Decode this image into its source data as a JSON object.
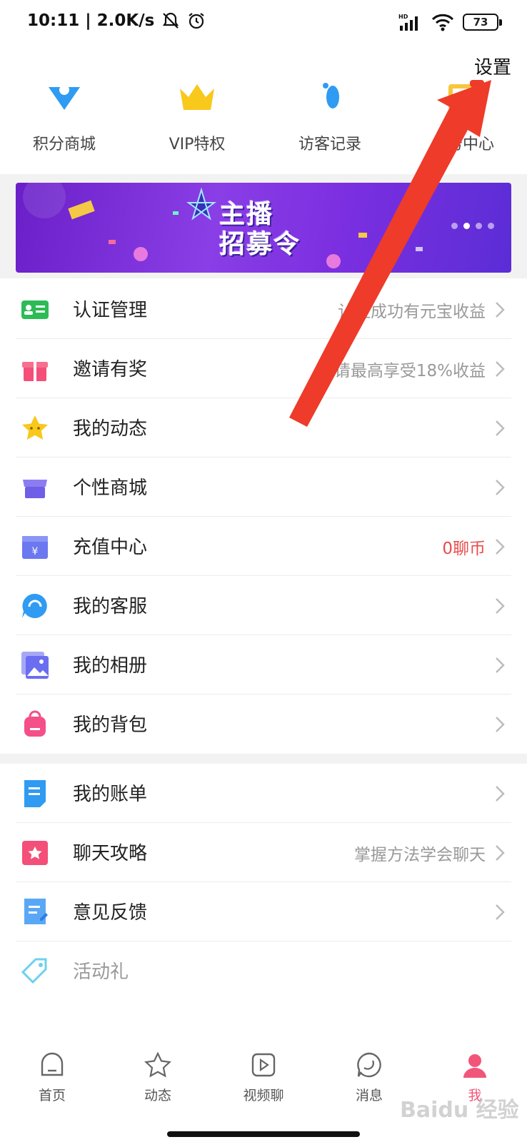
{
  "status_bar": {
    "time": "10:11 | 2.0K/s",
    "battery": "73",
    "network": "HD"
  },
  "header": {
    "settings_label": "设置"
  },
  "shortcuts": [
    {
      "label": "积分商城",
      "icon": "points-mall-icon"
    },
    {
      "label": "VIP特权",
      "icon": "crown-icon"
    },
    {
      "label": "访客记录",
      "icon": "footprint-icon"
    },
    {
      "label": "任务中心",
      "icon": "task-center-icon"
    }
  ],
  "banner": {
    "line1": "主播",
    "line2": "招募令",
    "slides": 4
  },
  "menu_group_1": [
    {
      "label": "认证管理",
      "value": "认证成功有元宝收益",
      "icon": "id-card-icon"
    },
    {
      "label": "邀请有奖",
      "value": "邀请最高享受18%收益",
      "icon": "gift-icon"
    },
    {
      "label": "我的动态",
      "value": "",
      "icon": "star-icon"
    },
    {
      "label": "个性商城",
      "value": "",
      "icon": "shop-icon"
    },
    {
      "label": "充值中心",
      "value": "0聊币",
      "icon": "wallet-icon"
    },
    {
      "label": "我的客服",
      "value": "",
      "icon": "headset-icon"
    },
    {
      "label": "我的相册",
      "value": "",
      "icon": "album-icon"
    },
    {
      "label": "我的背包",
      "value": "",
      "icon": "backpack-icon"
    }
  ],
  "menu_group_2": [
    {
      "label": "我的账单",
      "value": "",
      "icon": "bill-icon"
    },
    {
      "label": "聊天攻略",
      "value": "掌握方法学会聊天",
      "icon": "guide-icon"
    },
    {
      "label": "意见反馈",
      "value": "",
      "icon": "feedback-icon"
    },
    {
      "label": "活动礼",
      "value": "",
      "icon": "tag-icon"
    }
  ],
  "tabbar": [
    {
      "label": "首页",
      "icon": "home-icon"
    },
    {
      "label": "动态",
      "icon": "star-outline-icon"
    },
    {
      "label": "视频聊",
      "icon": "video-icon"
    },
    {
      "label": "消息",
      "icon": "message-icon"
    },
    {
      "label": "我",
      "icon": "profile-icon",
      "active": true
    }
  ],
  "watermark": "Baidu 经验",
  "colors": {
    "accent": "#f2557a",
    "arrow": "#ee3b2a",
    "red_value": "#e94c4c"
  }
}
